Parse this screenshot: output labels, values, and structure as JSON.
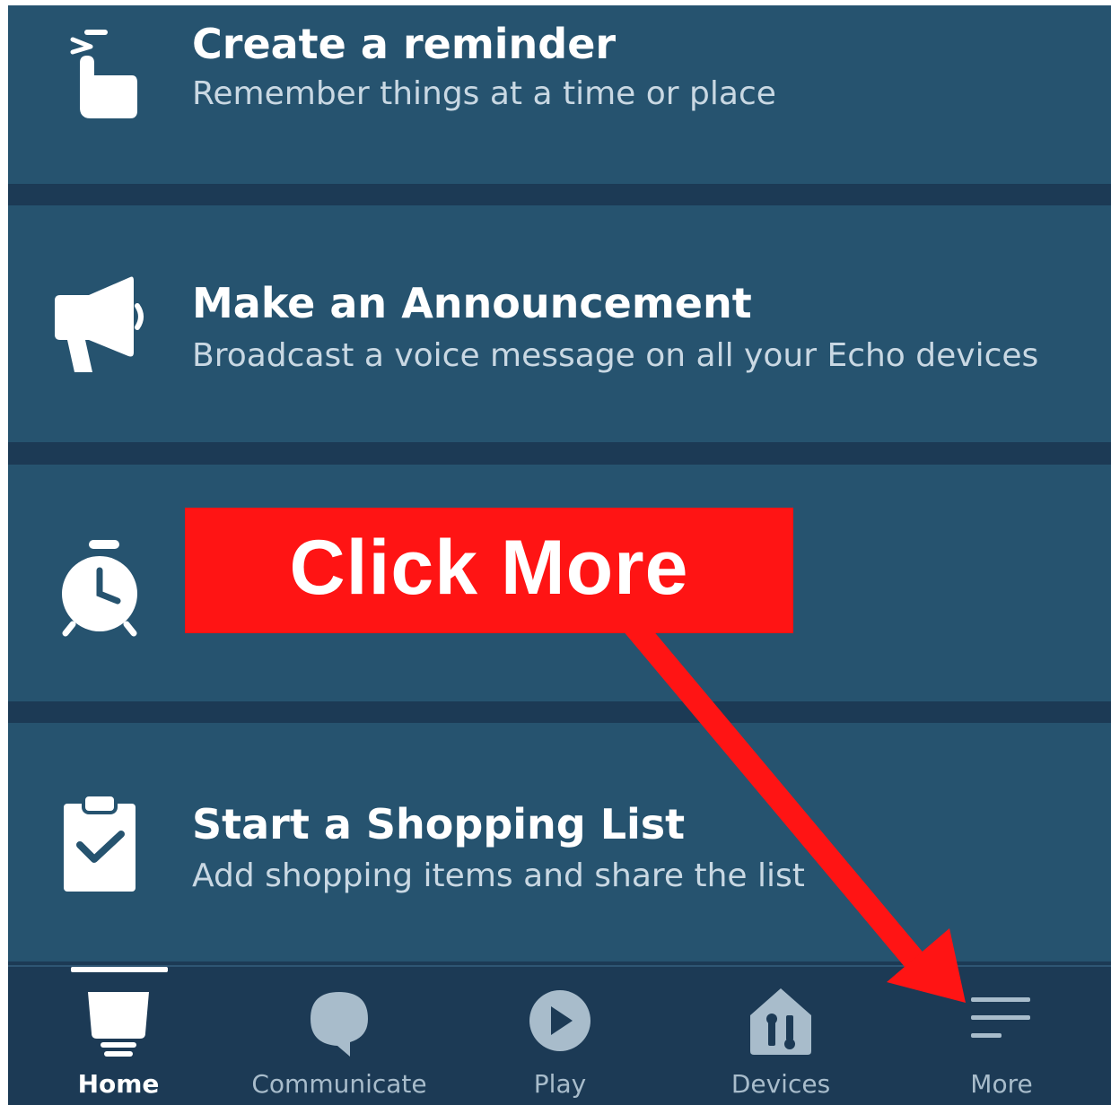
{
  "cards": [
    {
      "title": "Create a reminder",
      "subtitle": "Remember things at a time or place",
      "icon": "pinned-hand-icon"
    },
    {
      "title": "Make an Announcement",
      "subtitle": "Broadcast a voice message on all your Echo devices",
      "icon": "megaphone-icon"
    },
    {
      "title": "",
      "subtitle": "",
      "icon": "alarm-clock-icon"
    },
    {
      "title": "Start a Shopping List",
      "subtitle": "Add shopping items and share the list",
      "icon": "clipboard-check-icon"
    }
  ],
  "navbar": {
    "items": [
      {
        "label": "Home",
        "icon": "home-echo-icon",
        "active": true
      },
      {
        "label": "Communicate",
        "icon": "speech-bubble-icon",
        "active": false
      },
      {
        "label": "Play",
        "icon": "play-icon",
        "active": false
      },
      {
        "label": "Devices",
        "icon": "devices-house-icon",
        "active": false
      },
      {
        "label": "More",
        "icon": "menu-lines-icon",
        "active": false
      }
    ]
  },
  "annotation": {
    "callout_text": "Click More",
    "color": "#ff1414"
  },
  "colors": {
    "card_background": "#26536f",
    "app_background": "#1c3a55",
    "navbar_inactive": "#a8bccb"
  }
}
